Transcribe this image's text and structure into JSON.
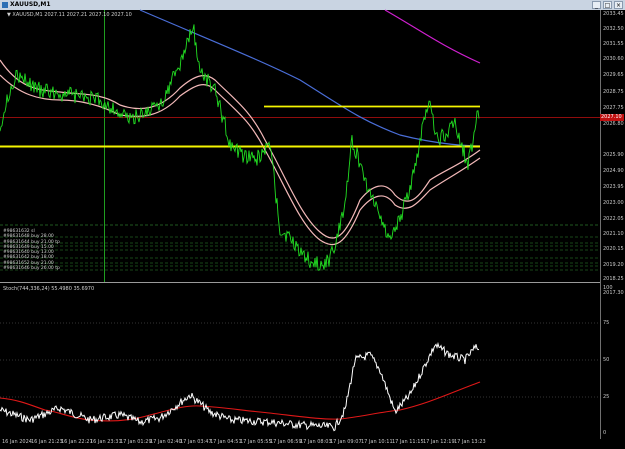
{
  "window": {
    "title": "XAUUSD,M1"
  },
  "window_buttons": [
    "_",
    "□",
    "×"
  ],
  "main_chart": {
    "header": "▼ XAUUSD,M1 2027.11 2027.21 2027.10 2027.10",
    "price_labels": [
      "2033.45",
      "2032.50",
      "2031.55",
      "2030.60",
      "2029.65",
      "2028.75",
      "2027.75",
      "2026.80",
      "2025.90",
      "2024.90",
      "2023.95",
      "2023.00",
      "2022.05",
      "2021.10",
      "2020.15",
      "2019.20",
      "2018.25",
      "2017.30"
    ],
    "current_price": "2027.10",
    "order_labels": [
      "#98631632 sl",
      "#98631648 buy 28.00",
      "#98631644 buy 21.00 tp",
      "#98631649 buy 15.00",
      "#98631640 buy 13.00",
      "#98631642 buy 18.00",
      "#98631652 buy 21.00",
      "#98631646 buy 26.00 tp"
    ]
  },
  "stoch": {
    "header": "Stoch(744,336,24) 55.4980 35.6970",
    "levels": [
      "100",
      "75",
      "50",
      "25",
      "0"
    ]
  },
  "time_axis": [
    "16 Jan 2024",
    "16 Jan 21:23",
    "16 Jan 22:27",
    "16 Jan 23:31",
    "17 Jan 01:29",
    "17 Jan 02:40",
    "17 Jan 03:47",
    "17 Jan 04:51",
    "17 Jan 05:55",
    "17 Jan 06:59",
    "17 Jan 08:03",
    "17 Jan 09:07",
    "17 Jan 10:11",
    "17 Jan 11:15",
    "17 Jan 12:19",
    "17 Jan 13:23"
  ],
  "colors": {
    "price": "#22dd22",
    "resistance": "#f5f500",
    "support": "#f5f500",
    "ma_blue": "#4a6ed8",
    "ma_magenta": "#d020d0",
    "ma_pink": "#f2b8b8",
    "stoch_main": "#ffffff",
    "stoch_signal": "#e01818",
    "current_price_line": "#c01010"
  }
}
